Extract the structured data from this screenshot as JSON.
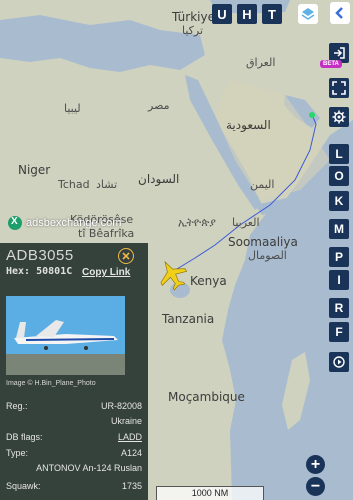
{
  "top_buttons": [
    "U",
    "H",
    "T"
  ],
  "right_buttons": [
    "L",
    "O",
    "K",
    "M",
    "P",
    "I",
    "R",
    "F"
  ],
  "beta_badge": "BETA",
  "map_labels": {
    "turkiye": "Türkiye",
    "turkiye_ar": "تركيا",
    "iraq": "العراق",
    "libya": "ليبيا",
    "egypt": "مصر",
    "saudi": "السعودية",
    "niger": "Niger",
    "chad": "Tchad",
    "chad_ar": "تشاد",
    "sudan": "السودان",
    "yemen": "اليمن",
    "kodorosese": "Ködörösêse",
    "ti_beafrika": "tî Bêafrîka",
    "ethiopia": "ኢትዮጵያ",
    "somalia_ar": "الصومال",
    "somalia": "Soomaaliya",
    "ladd": "LADD",
    "kenya": "Kenya",
    "tanzania": "Tanzania",
    "mocambique": "Moçambique",
    "ethiopia_sub": "العربيا"
  },
  "watermark": "adsbexchange.com",
  "panel": {
    "callsign": "ADB3055",
    "hex_label": "Hex:",
    "hex_value": "50801C",
    "copy_link": "Copy Link",
    "image_credit": "Image © H.Bin_Plane_Photo",
    "reg_label": "Reg.:",
    "reg_value": "UR-82008",
    "country": "Ukraine",
    "dbflags_label": "DB flags:",
    "dbflags_value": "LADD",
    "type_label": "Type:",
    "type_value": "A124",
    "type_name": "ANTONOV An-124 Ruslan",
    "squawk_label": "Squawk:",
    "squawk_value": "1735"
  },
  "scale_label": "1000 NM",
  "zoom_in": "+",
  "zoom_out": "−"
}
